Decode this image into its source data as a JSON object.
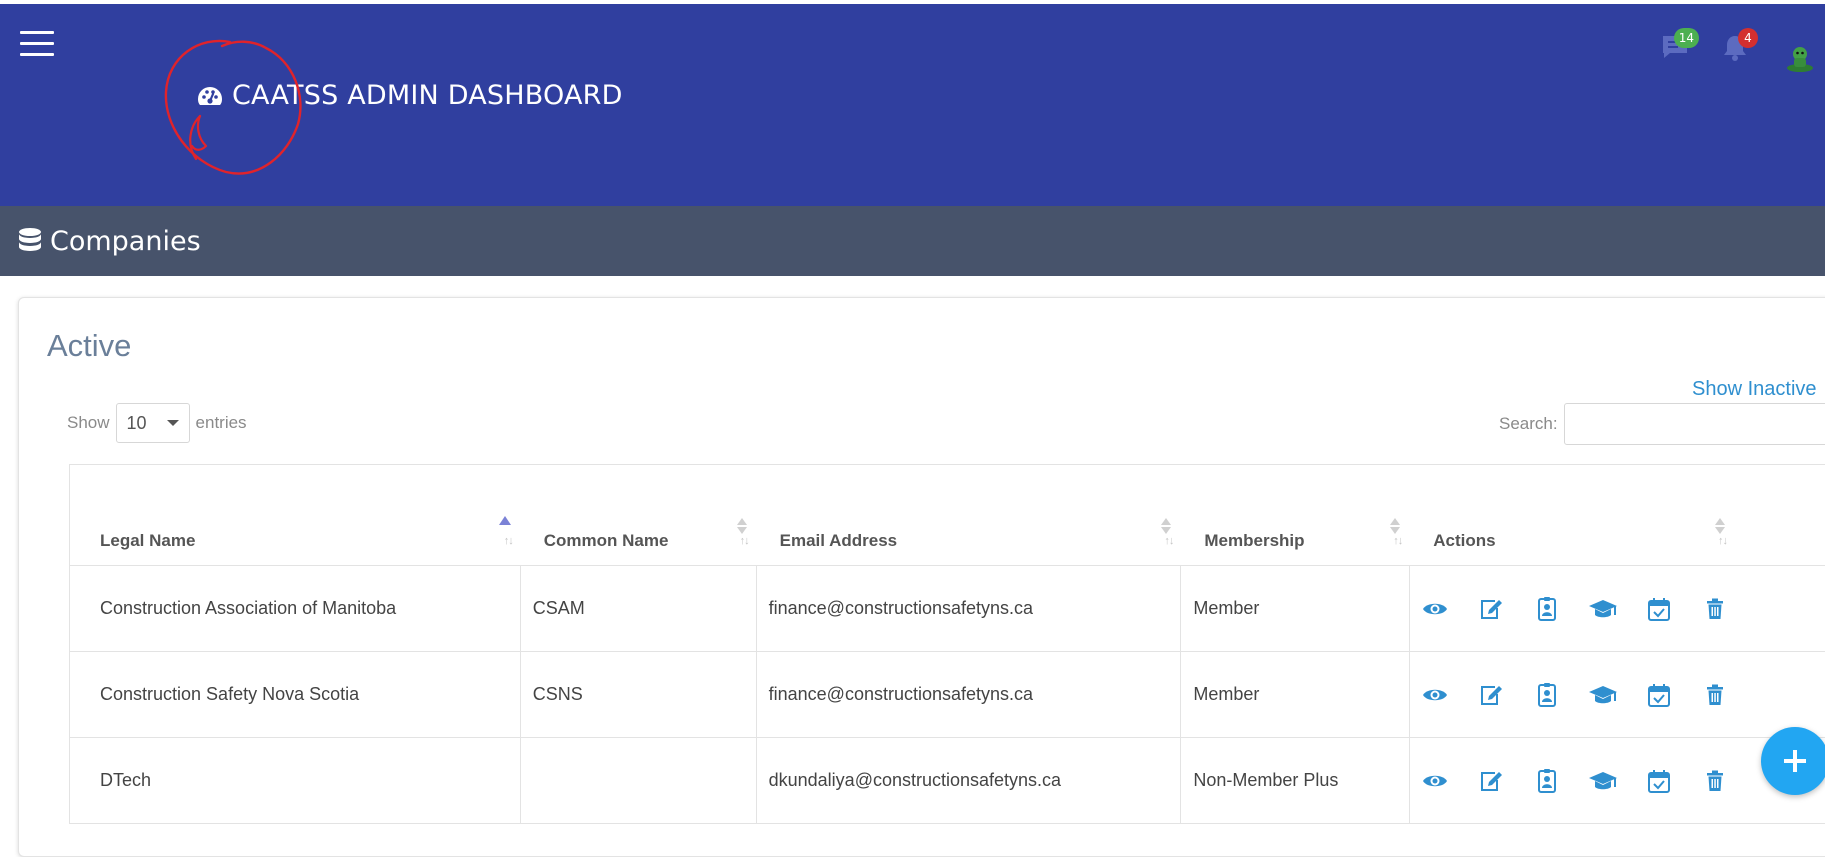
{
  "header": {
    "title": "CAATSS ADMIN DASHBOARD",
    "messages_count": "14",
    "notifications_count": "4"
  },
  "section": {
    "title": "Companies"
  },
  "card": {
    "title": "Active",
    "show_inactive_label": "Show Inactive",
    "show_label": "Show",
    "page_size": "10",
    "entries_label": "entries",
    "search_label": "Search:",
    "search_value": ""
  },
  "table": {
    "columns": [
      "Legal Name",
      "Common Name",
      "Email Address",
      "Membership",
      "Actions"
    ],
    "rows": [
      {
        "legal_name": "Construction Association of Manitoba",
        "common_name": "CSAM",
        "email": "finance@constructionsafetyns.ca",
        "membership": "Member"
      },
      {
        "legal_name": "Construction Safety Nova Scotia",
        "common_name": "CSNS",
        "email": "finance@constructionsafetyns.ca",
        "membership": "Member"
      },
      {
        "legal_name": "DTech",
        "common_name": "",
        "email": "dkundaliya@constructionsafetyns.ca",
        "membership": "Non-Member Plus"
      }
    ]
  },
  "icons": {
    "menu": "hamburger-icon",
    "title": "gauge-icon",
    "messages": "chat-icon",
    "notifications": "bell-icon",
    "avatar": "user-avatar-icon",
    "section": "database-icon",
    "actions": [
      "eye-icon",
      "edit-icon",
      "id-badge-icon",
      "graduation-cap-icon",
      "calendar-check-icon",
      "trash-icon"
    ],
    "fab": "plus-icon"
  },
  "colors": {
    "header": "#303f9f",
    "section_bar": "#47536b",
    "accent": "#2f8fcf",
    "fab": "#22a6f2",
    "badge_green": "#4caf50",
    "badge_red": "#d32f2f"
  }
}
